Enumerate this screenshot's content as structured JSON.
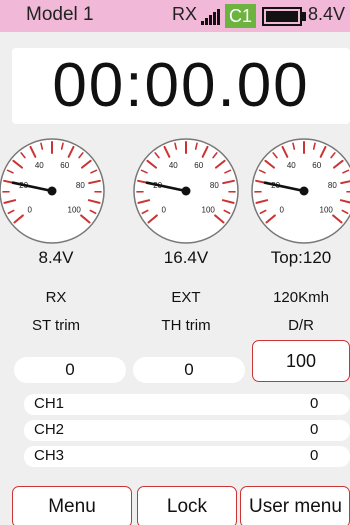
{
  "status_bar": {
    "model_name": "Model 1",
    "rx_label": "RX",
    "signal_icon": "signal-bars-icon",
    "channel_badge": "C1",
    "battery_icon": "battery-full-icon",
    "battery_voltage": "8.4V",
    "background_color": "#f2b8d8",
    "badge_color": "#6cb33f"
  },
  "timer": {
    "value": "00:00.00"
  },
  "gauge_dial_labels": [
    "0",
    "20",
    "40",
    "60",
    "80",
    "100"
  ],
  "gauges": [
    {
      "icon": "gauge-icon",
      "reading": "8.4V",
      "label": "RX"
    },
    {
      "icon": "gauge-icon",
      "reading": "16.4V",
      "label": "EXT"
    },
    {
      "icon": "gauge-icon",
      "reading": "Top:120",
      "label": "120Kmh"
    }
  ],
  "trims": {
    "st_label": "ST trim",
    "st_value": "0",
    "th_label": "TH trim",
    "th_value": "0",
    "dr_label": "D/R",
    "dr_value": "100"
  },
  "channels": [
    {
      "name": "CH1",
      "value": "0"
    },
    {
      "name": "CH2",
      "value": "0"
    },
    {
      "name": "CH3",
      "value": "0"
    }
  ],
  "buttons": {
    "menu": "Menu",
    "lock": "Lock",
    "user_menu": "User menu"
  },
  "accent_color": "#cc3333"
}
